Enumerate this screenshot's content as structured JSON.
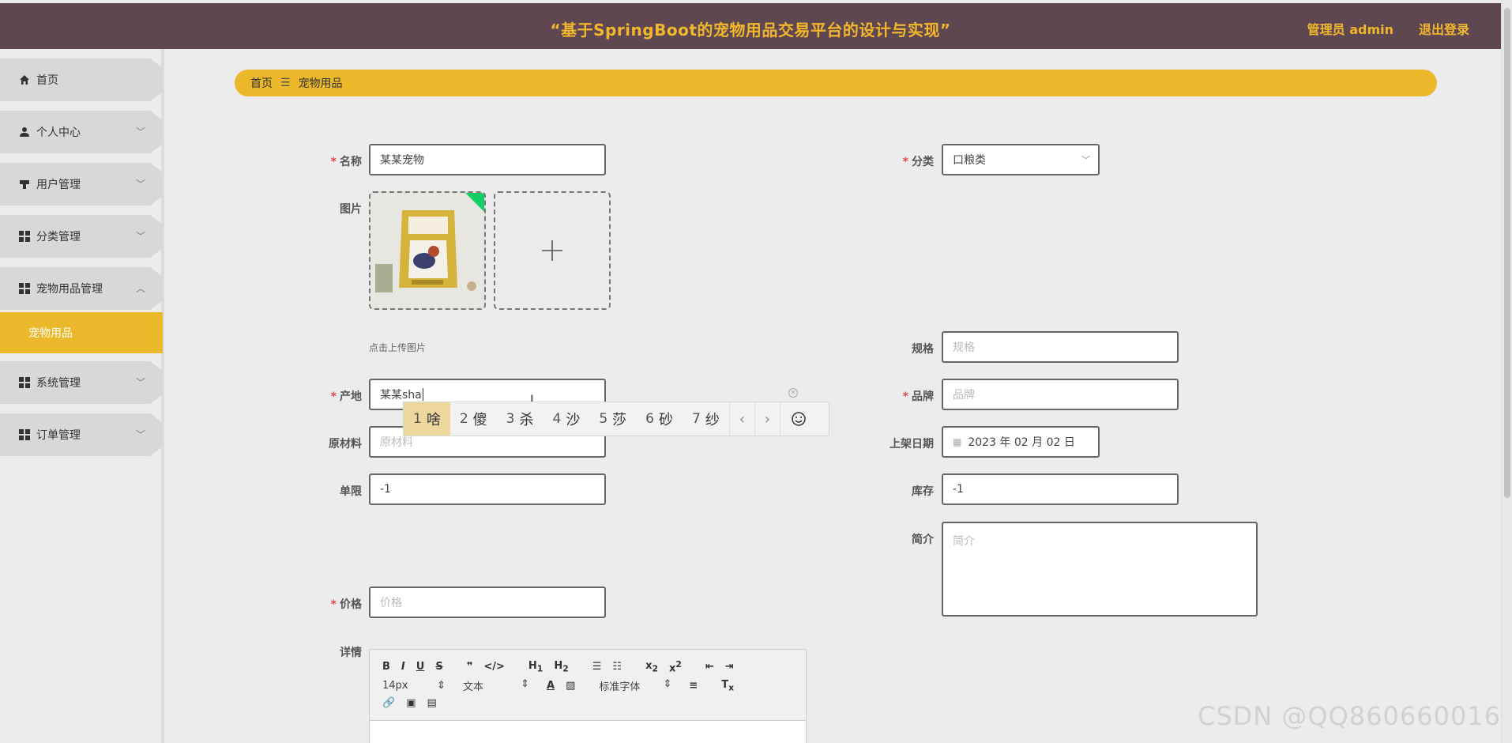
{
  "header": {
    "title": "“基于SpringBoot的宠物用品交易平台的设计与实现”",
    "user": "管理员 admin",
    "logout": "退出登录"
  },
  "sidebar": {
    "items": [
      {
        "label": "首页",
        "icon": "home-icon"
      },
      {
        "label": "个人中心",
        "icon": "user-icon"
      },
      {
        "label": "用户管理",
        "icon": "user-manage-icon"
      },
      {
        "label": "分类管理",
        "icon": "grid-icon"
      },
      {
        "label": "宠物用品管理",
        "icon": "grid-icon"
      },
      {
        "label": "系统管理",
        "icon": "grid-icon"
      },
      {
        "label": "订单管理",
        "icon": "grid-icon"
      }
    ],
    "active_sub": "宠物用品"
  },
  "breadcrumb": {
    "home": "首页",
    "current": "宠物用品"
  },
  "form": {
    "name_label": "名称",
    "name_value": "某某宠物",
    "category_label": "分类",
    "category_value": "口粮类",
    "image_label": "图片",
    "upload_hint": "点击上传图片",
    "spec_label": "规格",
    "spec_placeholder": "规格",
    "origin_label": "产地",
    "origin_value": "某某sha",
    "brand_label": "品牌",
    "brand_placeholder": "品牌",
    "material_label": "原材料",
    "material_placeholder": "原材料",
    "date_label": "上架日期",
    "date_value": "2023 年 02 月 02 日",
    "limit_label": "单限",
    "limit_value": "-1",
    "stock_label": "库存",
    "stock_value": "-1",
    "intro_label": "简介",
    "intro_placeholder": "简介",
    "price_label": "价格",
    "price_placeholder": "价格",
    "detail_label": "详情"
  },
  "ime": {
    "candidates": [
      {
        "n": "1",
        "c": "啥"
      },
      {
        "n": "2",
        "c": "傻"
      },
      {
        "n": "3",
        "c": "杀"
      },
      {
        "n": "4",
        "c": "沙"
      },
      {
        "n": "5",
        "c": "莎"
      },
      {
        "n": "6",
        "c": "砂"
      },
      {
        "n": "7",
        "c": "纱"
      }
    ]
  },
  "editor": {
    "font_size": "14px",
    "text_type": "文本",
    "font_family": "标准字体"
  },
  "watermark": "CSDN @QQ860660016",
  "colors": {
    "header_bg": "#5e4750",
    "accent": "#ebb829",
    "required": "#e04a4a"
  }
}
